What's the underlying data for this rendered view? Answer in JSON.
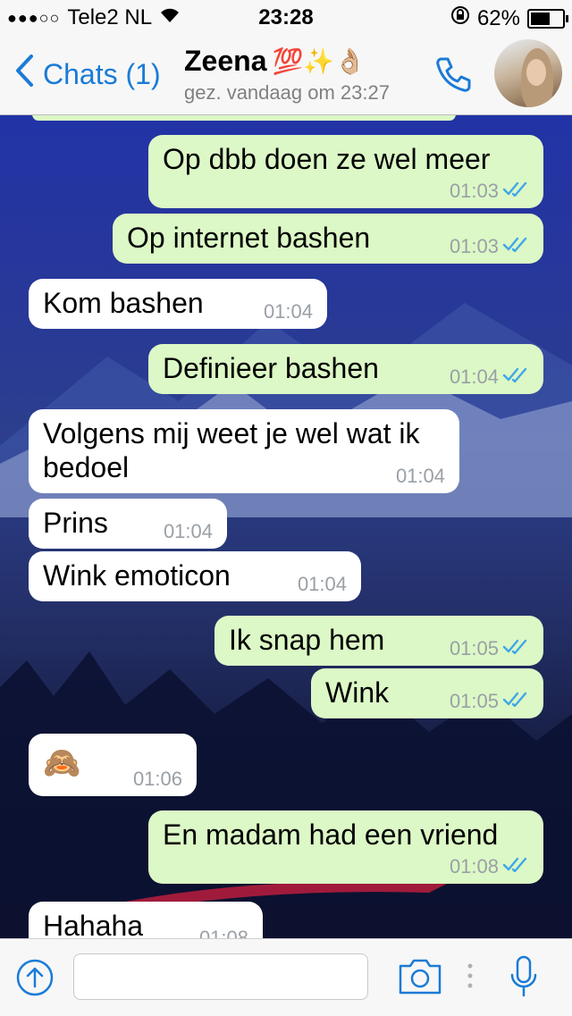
{
  "status_bar": {
    "signal": "●●●○○",
    "carrier": "Tele2 NL",
    "time": "23:28",
    "battery_text": "62%",
    "battery_level": 0.62
  },
  "header": {
    "back_label": "Chats (1)",
    "contact_name": "Zeena",
    "name_emojis": "💯✨👌🏼",
    "last_seen": "gez. vandaag om 23:27"
  },
  "messages": [
    {
      "dir": "out",
      "text": "Op dbb doen ze wel meer",
      "time": "01:03",
      "read": true
    },
    {
      "dir": "out",
      "text": "Op internet bashen",
      "time": "01:03",
      "read": true
    },
    {
      "dir": "in",
      "text": "Kom bashen",
      "time": "01:04"
    },
    {
      "dir": "out",
      "text": "Definieer bashen",
      "time": "01:04",
      "read": true
    },
    {
      "dir": "in",
      "text": "Volgens mij weet je wel wat ik",
      "text2": "bedoel",
      "time": "01:04"
    },
    {
      "dir": "in",
      "text": "Prins",
      "time": "01:04"
    },
    {
      "dir": "in",
      "text": "Wink emoticon",
      "time": "01:04"
    },
    {
      "dir": "out",
      "text": "Ik snap hem",
      "time": "01:05",
      "read": true
    },
    {
      "dir": "out",
      "text": "Wink",
      "time": "01:05",
      "read": true
    },
    {
      "dir": "in",
      "text": "🙈",
      "time": "01:06"
    },
    {
      "dir": "out",
      "text": "En madam had een vriend",
      "time": "01:08",
      "read": true
    },
    {
      "dir": "in",
      "text": "Hahaha",
      "time": "01:08"
    }
  ],
  "input": {
    "placeholder": ""
  },
  "colors": {
    "accent": "#1a7bd6",
    "outgoing_bubble": "#dcf8c6",
    "incoming_bubble": "#ffffff",
    "read_ticks": "#3fa7e8"
  }
}
